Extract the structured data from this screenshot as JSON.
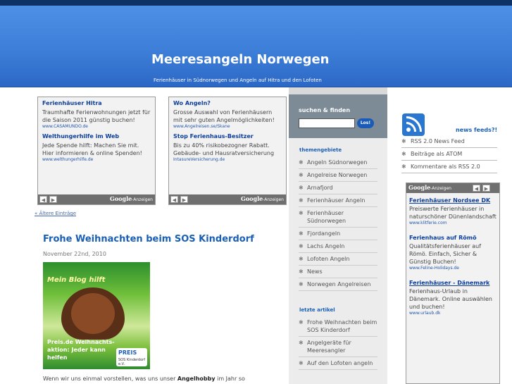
{
  "site": {
    "title": "Meeresangeln Norwegen",
    "description": "Ferienhäuser in Südnorwegen und Angeln auf Hitra und den Lofoten"
  },
  "ads_top": [
    {
      "items": [
        {
          "title": "Ferienhäuser Hitra",
          "text": "Traumhafte Ferienwohnungen jetzt für die Saison 2011 günstig buchen!",
          "url": "www.CASAMUNDO.de"
        },
        {
          "title": "Welthungerhilfe im Web",
          "text": "Jede Spende hilft: Machen Sie mit. Hier informieren & online Spenden!",
          "url": "www.welthungerhilfe.de"
        }
      ]
    },
    {
      "items": [
        {
          "title": "Wo Angeln?",
          "text": "Grosse Auswahl von Ferienhäusern mit sehr guten Angelmöglichkeiten!",
          "url": "www.Angelreisen.se/Skane"
        },
        {
          "title": "Stop Ferienhaus-Besitzer",
          "text": "Bis zu 40% risikobezogner Rabatt. Gebäude- und Hausratversicherung",
          "url": "IntasureVersicherung.de"
        }
      ]
    }
  ],
  "ad_footer": {
    "google": "Google",
    "anzeigen": "-Anzeigen",
    "prev": "◀",
    "next": "▶"
  },
  "older_entries": "« Ältere Einträge",
  "post": {
    "title": "Frohe Weihnachten beim SOS Kinderdorf",
    "date": "November 22nd, 2010",
    "image_caption_top": "Mein Blog hilft",
    "image_caption_bottom": "Preis.de Weihnachts-aktion: Jeder kann helfen",
    "image_badge": "PREIS",
    "image_badge_sub": "SOS Kinderdorf e.V.",
    "excerpt_start": "Wenn wir uns einmal vorstellen, was uns unser ",
    "excerpt_bold": "Angelhobby",
    "excerpt_end": " im Jahr so"
  },
  "sidebar": {
    "search_label": "suchen & finden",
    "search_button": "Los!",
    "themes_heading": "themengebiete",
    "themes": [
      "Angeln Südnorwegen",
      "Angelreise Norwegen",
      "Arnafjord",
      "Ferienhäuser Angeln",
      "Ferienhäuser Südnorwegen",
      "Fjordangeln",
      "Lachs Angeln",
      "Lofoten Angeln",
      "News",
      "Norwegen Angelreisen"
    ],
    "recent_heading": "letzte artikel",
    "recent": [
      "Frohe Weihnachten beim SOS Kinderdorf",
      "Angelgeräte für Meeresangler",
      "Auf den Lofoten angeln"
    ]
  },
  "feeds": {
    "title": "news feeds?!",
    "items": [
      "RSS 2.0 News Feed",
      "Beiträge als ATOM",
      "Kommentare als RSS 2.0"
    ]
  },
  "right_ad": {
    "header": "Google",
    "header_sub": "-Anzeigen",
    "items": [
      {
        "title": "Ferienhäuser Nordsee DK",
        "text": "Preiswerte Ferienhäuser in naturschöner Dünenlandschaft",
        "url": "www.klitferie.com"
      },
      {
        "title": "Ferienhaus auf Römö",
        "text": "Qualitätsferienhäuser auf Römö. Einfach, Sicher & Günstig Buchen!",
        "url": "www.Feline-Holidays.de"
      },
      {
        "title": "Ferienhäuser - Dänemark",
        "text": "Ferienhaus-Urlaub in Dänemark. Online auswählen und buchen!",
        "url": "www.urlaub.dk"
      }
    ]
  }
}
